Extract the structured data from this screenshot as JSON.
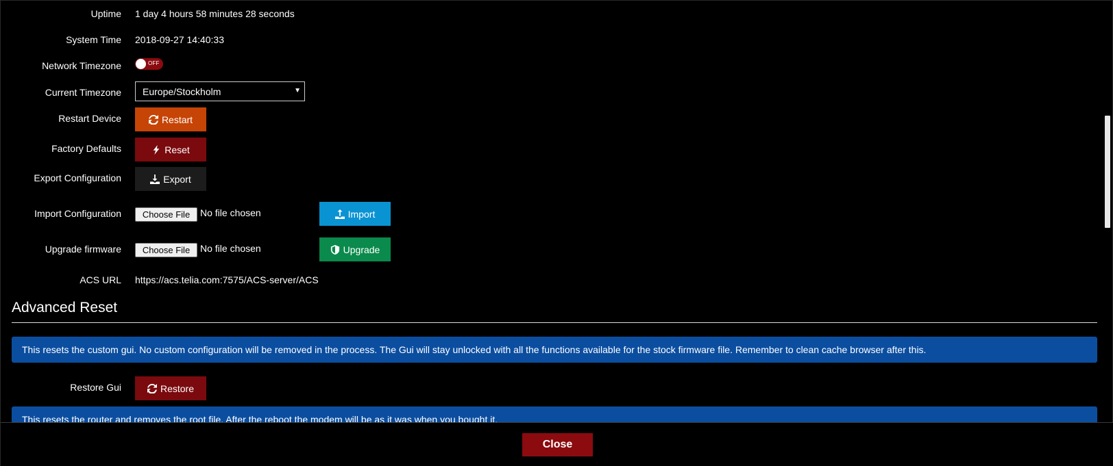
{
  "system": {
    "uptime_label": "Uptime",
    "uptime_value": "1 day 4 hours 58 minutes 28 seconds",
    "system_time_label": "System Time",
    "system_time_value": "2018-09-27 14:40:33",
    "network_timezone_label": "Network Timezone",
    "network_timezone_toggle": "OFF",
    "current_timezone_label": "Current Timezone",
    "current_timezone_value": "Europe/Stockholm",
    "restart_label": "Restart Device",
    "restart_button": "Restart",
    "factory_label": "Factory Defaults",
    "factory_button": "Reset",
    "export_label": "Export Configuration",
    "export_button": "Export",
    "import_label": "Import Configuration",
    "import_choose": "Choose File",
    "import_file_status": "No file chosen",
    "import_button": "Import",
    "upgrade_label": "Upgrade firmware",
    "upgrade_choose": "Choose File",
    "upgrade_file_status": "No file chosen",
    "upgrade_button": "Upgrade",
    "acs_label": "ACS URL",
    "acs_value": "https://acs.telia.com:7575/ACS-server/ACS"
  },
  "advanced": {
    "title": "Advanced Reset",
    "gui_info": "This resets the custom gui. No custom configuration will be removed in the process. The Gui will stay unlocked with all the functions available for the stock firmware file. Remember to clean cache browser after this.",
    "restore_label": "Restore Gui",
    "restore_button": "Restore",
    "router_info": "This resets the router and removes the root file. After the reboot the modem will be as it was when you bought it."
  },
  "footer": {
    "close_button": "Close"
  },
  "colors": {
    "restart": "#c64405",
    "reset": "#7a0a0e",
    "export": "#1c1c1c",
    "import": "#0a93d3",
    "upgrade": "#0a8a4c",
    "alert": "#0b4ea0",
    "close": "#8b0b0f"
  }
}
